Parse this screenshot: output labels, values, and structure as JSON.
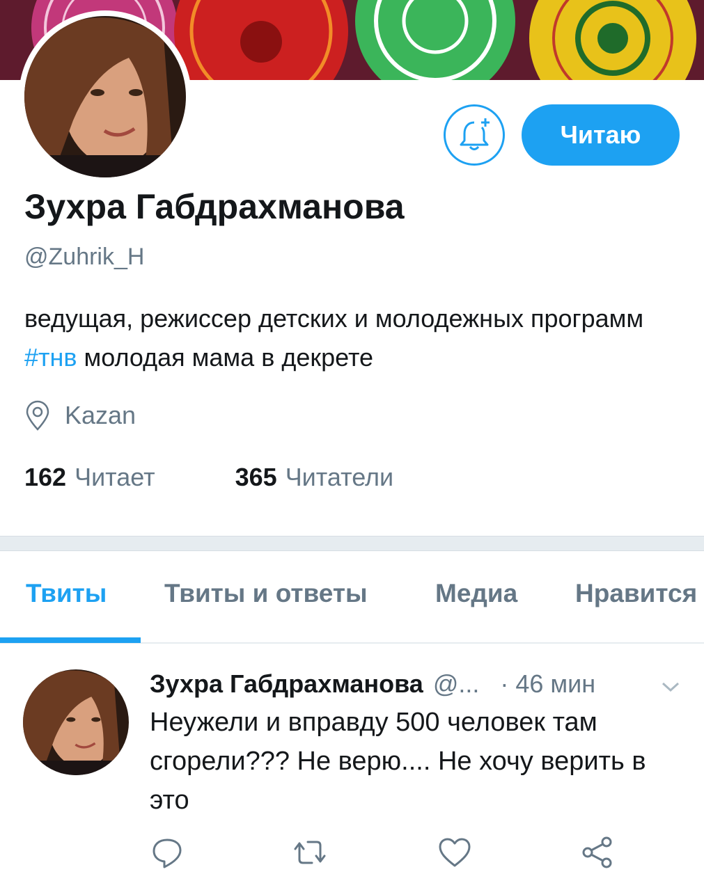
{
  "profile": {
    "name": "Зухра Габдрахманова",
    "handle": "@Zuhrik_H",
    "bio_part1": "ведущая, режиссер детских и молодежных программ ",
    "bio_hashtag": "#тнв",
    "bio_part2": " молодая мама в декрете",
    "location": "Kazan",
    "following_count": "162",
    "following_label": "Читает",
    "followers_count": "365",
    "followers_label": "Читатели",
    "follow_button_label": "Читаю"
  },
  "tabs": [
    {
      "label": "Твиты",
      "active": true
    },
    {
      "label": "Твиты и ответы",
      "active": false
    },
    {
      "label": "Медиа",
      "active": false
    },
    {
      "label": "Нравится",
      "active": false
    }
  ],
  "tweet": {
    "author_name": "Зухра Габдрахманова",
    "author_handle": "@...",
    "time": "· 46 мин",
    "text": "Неужели и вправду 500 человек там сгорели??? Не верю.... Не хочу верить в это"
  },
  "icons": {
    "notify": "bell-plus-icon",
    "location": "location-pin-icon",
    "reply": "reply-icon",
    "retweet": "retweet-icon",
    "like": "heart-icon",
    "share": "share-icon",
    "more": "chevron-down-icon"
  },
  "colors": {
    "accent": "#1da1f2",
    "text": "#14171a",
    "secondary": "#657786",
    "divider": "#e6ecf0"
  }
}
